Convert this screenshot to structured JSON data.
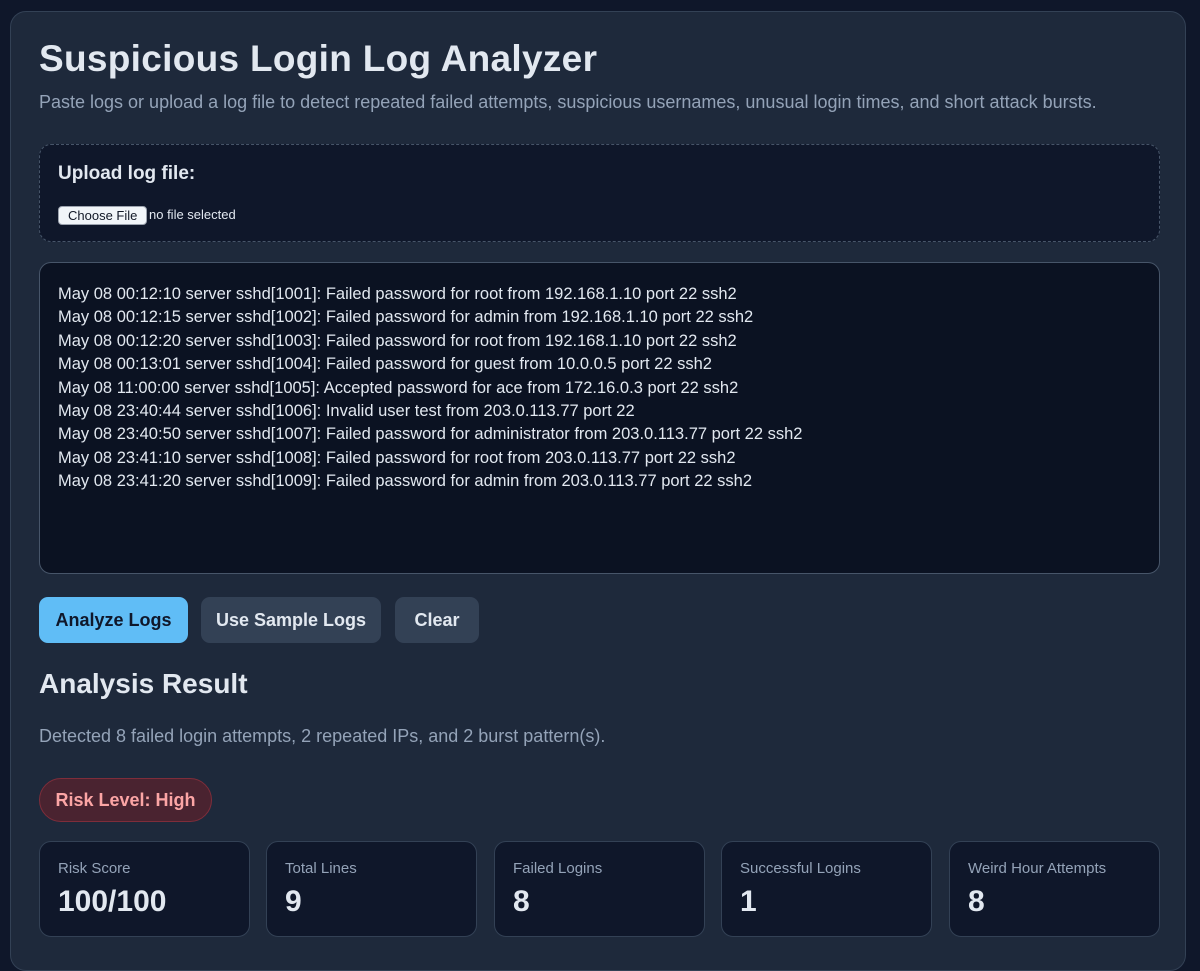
{
  "header": {
    "title": "Suspicious Login Log Analyzer",
    "subtitle": "Paste logs or upload a log file to detect repeated failed attempts, suspicious usernames, unusual login times, and short attack bursts."
  },
  "upload": {
    "label": "Upload log file:",
    "button_label": "Choose File",
    "status": "no file selected"
  },
  "log_input": {
    "lines": [
      "May 08 00:12:10 server sshd[1001]: Failed password for root from 192.168.1.10 port 22 ssh2",
      "May 08 00:12:15 server sshd[1002]: Failed password for admin from 192.168.1.10 port 22 ssh2",
      "May 08 00:12:20 server sshd[1003]: Failed password for root from 192.168.1.10 port 22 ssh2",
      "May 08 00:13:01 server sshd[1004]: Failed password for guest from 10.0.0.5 port 22 ssh2",
      "May 08 11:00:00 server sshd[1005]: Accepted password for ace from 172.16.0.3 port 22 ssh2",
      "May 08 23:40:44 server sshd[1006]: Invalid user test from 203.0.113.77 port 22",
      "May 08 23:40:50 server sshd[1007]: Failed password for administrator from 203.0.113.77 port 22 ssh2",
      "May 08 23:41:10 server sshd[1008]: Failed password for root from 203.0.113.77 port 22 ssh2",
      "May 08 23:41:20 server sshd[1009]: Failed password for admin from 203.0.113.77 port 22 ssh2"
    ]
  },
  "actions": {
    "analyze_label": "Analyze Logs",
    "sample_label": "Use Sample Logs",
    "clear_label": "Clear"
  },
  "result": {
    "heading": "Analysis Result",
    "summary": "Detected 8 failed login attempts, 2 repeated IPs, and 2 burst pattern(s).",
    "risk_level": "Risk Level: High",
    "stats": [
      {
        "label": "Risk Score",
        "value": "100/100"
      },
      {
        "label": "Total Lines",
        "value": "9"
      },
      {
        "label": "Failed Logins",
        "value": "8"
      },
      {
        "label": "Successful Logins",
        "value": "1"
      },
      {
        "label": "Weird Hour Attempts",
        "value": "8"
      }
    ]
  },
  "colors": {
    "background": "#0f172a",
    "panel": "#1e293b",
    "accent": "#60bdf6",
    "risk_high": "#fca5a5"
  }
}
